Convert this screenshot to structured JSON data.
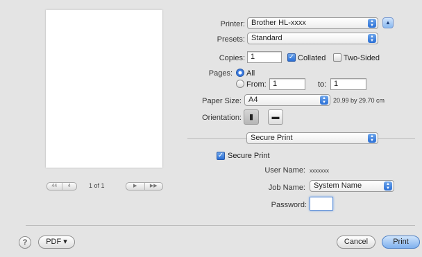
{
  "preview": {
    "nav_first": "44",
    "nav_prev": "4",
    "page_indicator": "1 of 1",
    "nav_next": "▶",
    "nav_last": "▶▶"
  },
  "printer": {
    "label": "Printer:",
    "value": "Brother HL-xxxx",
    "disclosure_icon": "triangle-up-icon"
  },
  "presets": {
    "label": "Presets:",
    "value": "Standard"
  },
  "copies": {
    "label": "Copies:",
    "value": "1",
    "collated_label": "Collated",
    "collated_checked": true,
    "two_sided_label": "Two-Sided",
    "two_sided_checked": false
  },
  "pages": {
    "label": "Pages:",
    "all_label": "All",
    "from_label": "From:",
    "from_value": "1",
    "to_label": "to:",
    "to_value": "1",
    "selected": "All"
  },
  "paper_size": {
    "label": "Paper Size:",
    "value": "A4",
    "dimensions": "20.99 by 29.70 cm"
  },
  "orientation": {
    "label": "Orientation:",
    "portrait_icon": "portrait-icon",
    "landscape_icon": "landscape-icon"
  },
  "section_popup": {
    "value": "Secure Print"
  },
  "secure": {
    "checkbox_label": "Secure Print",
    "checked": true,
    "user_name_label": "User Name:",
    "user_name_value": "xxxxxxx",
    "job_name_label": "Job Name:",
    "job_name_value": "System Name",
    "password_label": "Password:",
    "password_value": ""
  },
  "footer": {
    "help": "?",
    "pdf": "PDF ▾",
    "cancel": "Cancel",
    "print": "Print"
  },
  "colors": {
    "accent": "#2a6fd6",
    "background": "#e4e4e4"
  }
}
